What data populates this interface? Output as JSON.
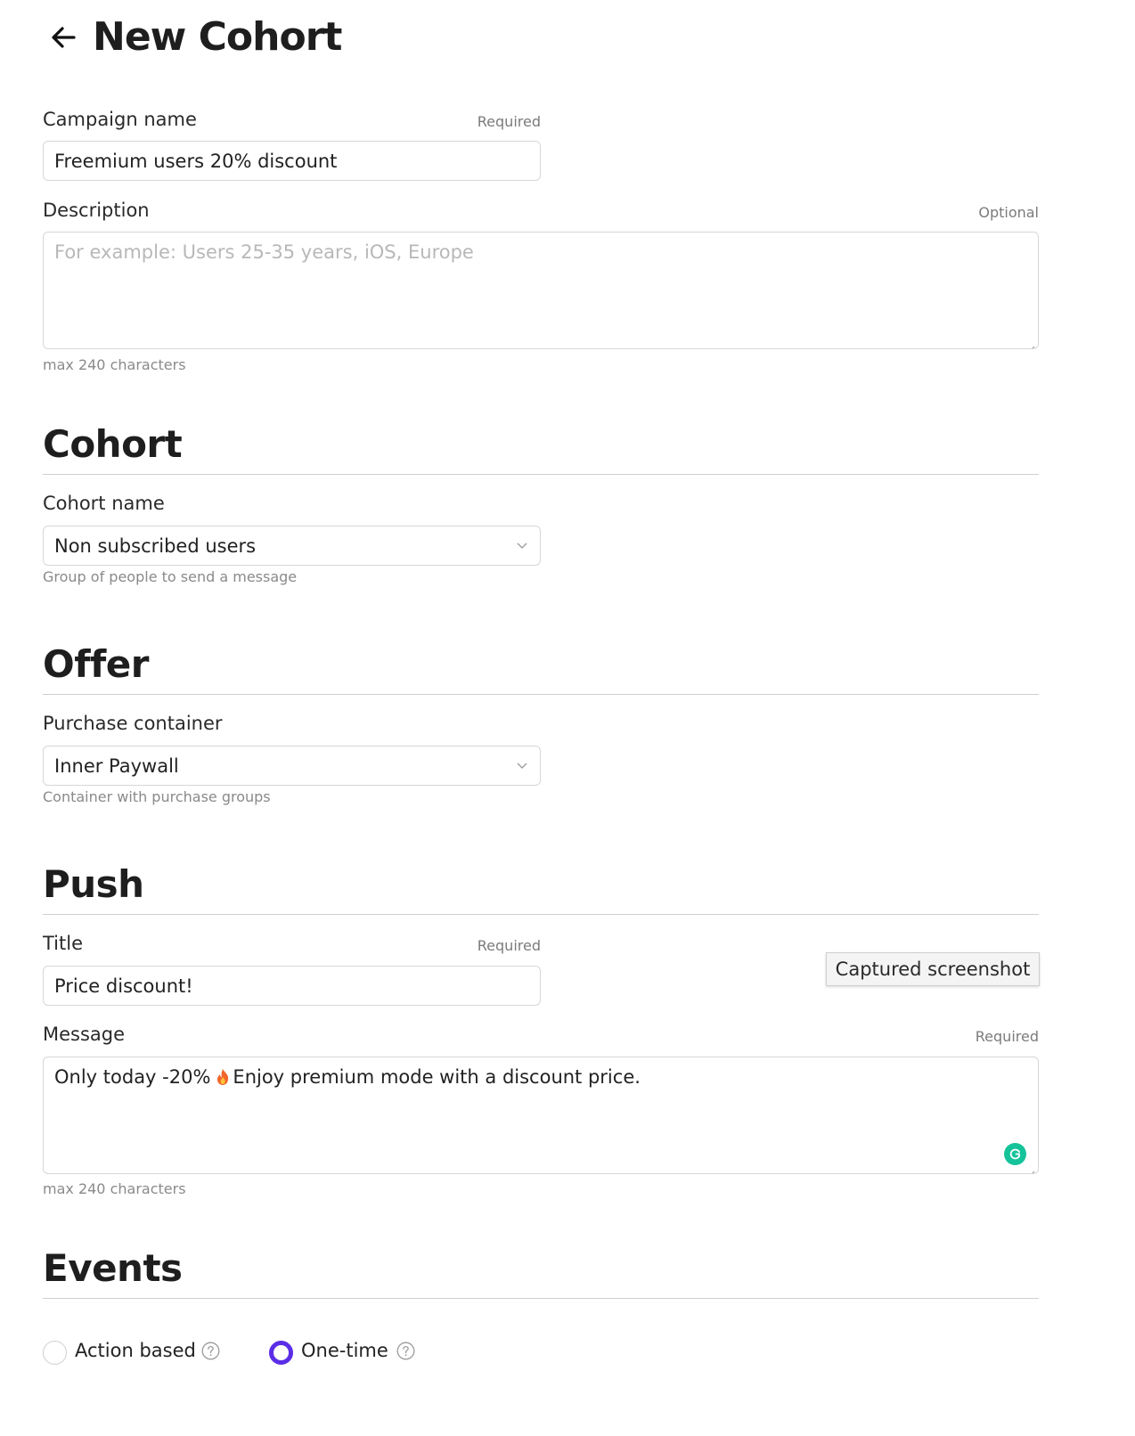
{
  "page": {
    "title": "New Cohort"
  },
  "campaign": {
    "label": "Campaign name",
    "required_text": "Required",
    "value": "Freemium users 20% discount"
  },
  "description": {
    "label": "Description",
    "optional_text": "Optional",
    "placeholder": "For example: Users 25-35 years, iOS, Europe",
    "value": "",
    "note": "max 240 characters"
  },
  "cohort_section": {
    "title": "Cohort",
    "field_label": "Cohort name",
    "selected": "Non subscribed users",
    "hint": "Group of people to send a message"
  },
  "offer_section": {
    "title": "Offer",
    "field_label": "Purchase container",
    "selected": "Inner Paywall",
    "hint": "Container with purchase groups"
  },
  "push_section": {
    "title": "Push",
    "title_field": {
      "label": "Title",
      "required_text": "Required",
      "value": "Price discount!"
    },
    "message_field": {
      "label": "Message",
      "required_text": "Required",
      "value_before_emoji": "Only today -20%",
      "emoji": "fire",
      "value_after_emoji": "Enjoy premium mode with a discount price.",
      "note": "max 240 characters"
    }
  },
  "tooltip": {
    "text": "Captured screenshot"
  },
  "events_section": {
    "title": "Events",
    "options": [
      {
        "label": "Action based",
        "selected": false
      },
      {
        "label": "One-time",
        "selected": true
      }
    ]
  },
  "colors": {
    "accent": "#5b2ee6",
    "grammarly": "#15c39a",
    "border": "#d7d7d7",
    "divider": "#cfcfcf"
  },
  "icons": {
    "back": "arrow-left-icon",
    "dropdown": "chevron-down-icon",
    "help": "question-circle-icon",
    "grammarly": "grammarly-icon",
    "fire": "fire-emoji-icon"
  }
}
